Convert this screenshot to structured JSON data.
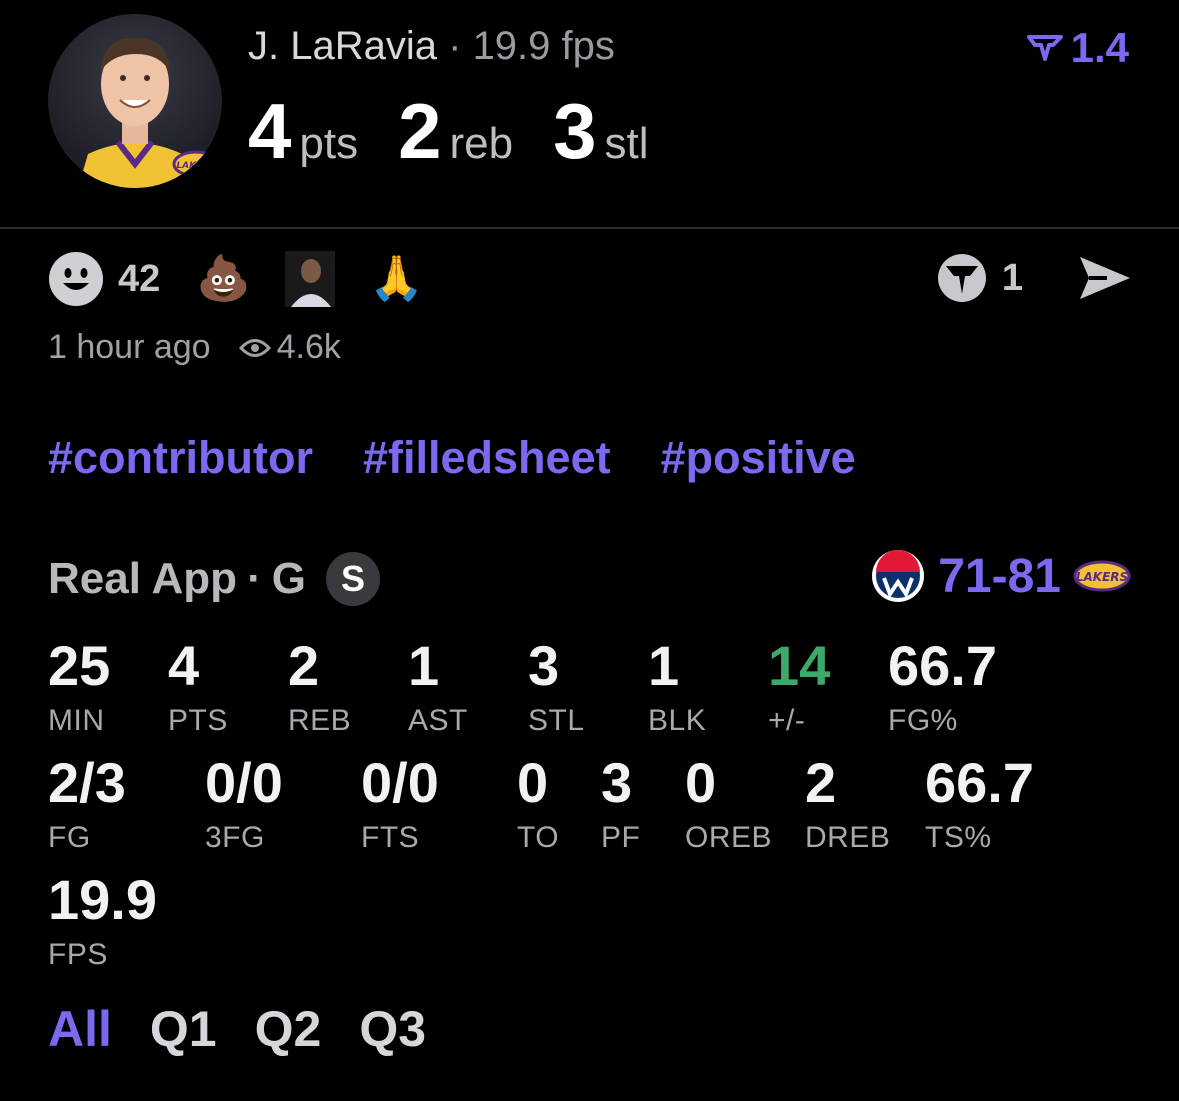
{
  "header": {
    "player_name": "J. LaRavia",
    "separator": "·",
    "fps": "19.9 fps",
    "rating": "1.4",
    "statline": [
      {
        "value": "4",
        "unit": "pts"
      },
      {
        "value": "2",
        "unit": "reb"
      },
      {
        "value": "3",
        "unit": "stl"
      }
    ]
  },
  "reactions": {
    "smile_count": "42",
    "emojis": [
      "💩",
      "🙏"
    ],
    "comment_count": "1"
  },
  "meta": {
    "time_ago": "1 hour ago",
    "views": "4.6k"
  },
  "tags": [
    "#contributor",
    "#filledsheet",
    "#positive"
  ],
  "game": {
    "source": "Real App",
    "separator": "·",
    "position": "G",
    "badge": "S",
    "score_left": "71",
    "score_dash": "-",
    "score_right": "81"
  },
  "stats": [
    {
      "value": "25",
      "label": "MIN"
    },
    {
      "value": "4",
      "label": "PTS"
    },
    {
      "value": "2",
      "label": "REB"
    },
    {
      "value": "1",
      "label": "AST"
    },
    {
      "value": "3",
      "label": "STL"
    },
    {
      "value": "1",
      "label": "BLK"
    },
    {
      "value": "14",
      "label": "+/-"
    },
    {
      "value": "66.7",
      "label": "FG%"
    },
    {
      "value": "2/3",
      "label": "FG"
    },
    {
      "value": "0/0",
      "label": "3FG"
    },
    {
      "value": "0/0",
      "label": "FTS"
    },
    {
      "value": "0",
      "label": "TO"
    },
    {
      "value": "3",
      "label": "PF"
    },
    {
      "value": "0",
      "label": "OREB"
    },
    {
      "value": "2",
      "label": "DREB"
    },
    {
      "value": "66.7",
      "label": "TS%"
    },
    {
      "value": "19.9",
      "label": "FPS"
    }
  ],
  "periods": [
    "All",
    "Q1",
    "Q2",
    "Q3"
  ],
  "colors": {
    "accent": "#7b6af0",
    "positive": "#3ea868",
    "background": "#000000"
  }
}
